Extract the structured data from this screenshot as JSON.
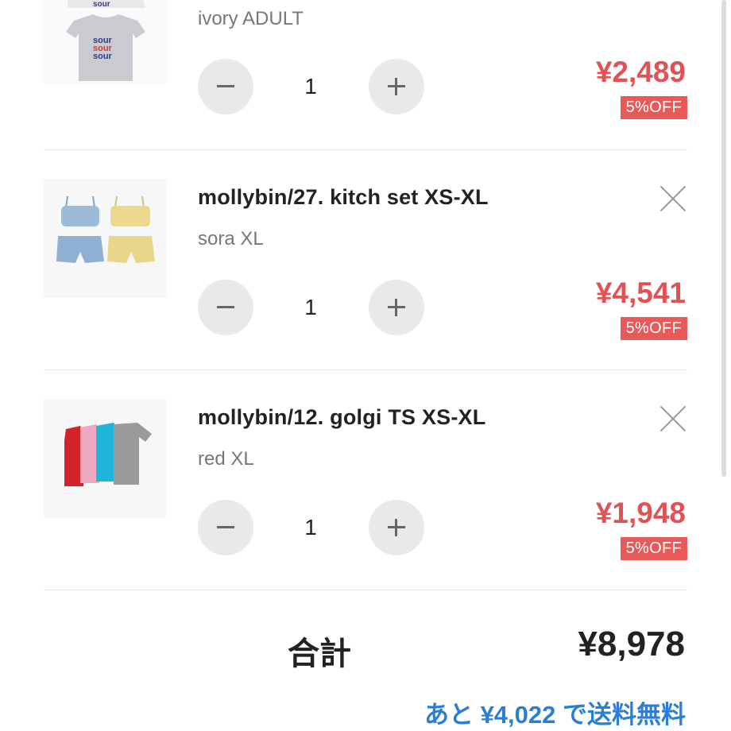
{
  "cart": {
    "items": [
      {
        "title": "",
        "variant": "ivory ADULT",
        "quantity": "1",
        "price": "¥2,489",
        "discount": "5%OFF",
        "image_icon": "tshirt-image"
      },
      {
        "title": "mollybin/27. kitch set XS-XL",
        "variant": "sora XL",
        "quantity": "1",
        "price": "¥4,541",
        "discount": "5%OFF",
        "image_icon": "kitch-set-image"
      },
      {
        "title": "mollybin/12. golgi TS XS-XL",
        "variant": "red XL",
        "quantity": "1",
        "price": "¥1,948",
        "discount": "5%OFF",
        "image_icon": "golgi-tshirt-image"
      }
    ],
    "tshirt_print_text": "sour"
  },
  "summary": {
    "total_label": "合計",
    "total_value": "¥8,978",
    "shipping_note": "あと ¥4,022 で送料無料"
  },
  "colors": {
    "price": "#e05355",
    "discount_badge": "#e85a5a",
    "shipping_link": "#2a7fd4"
  }
}
